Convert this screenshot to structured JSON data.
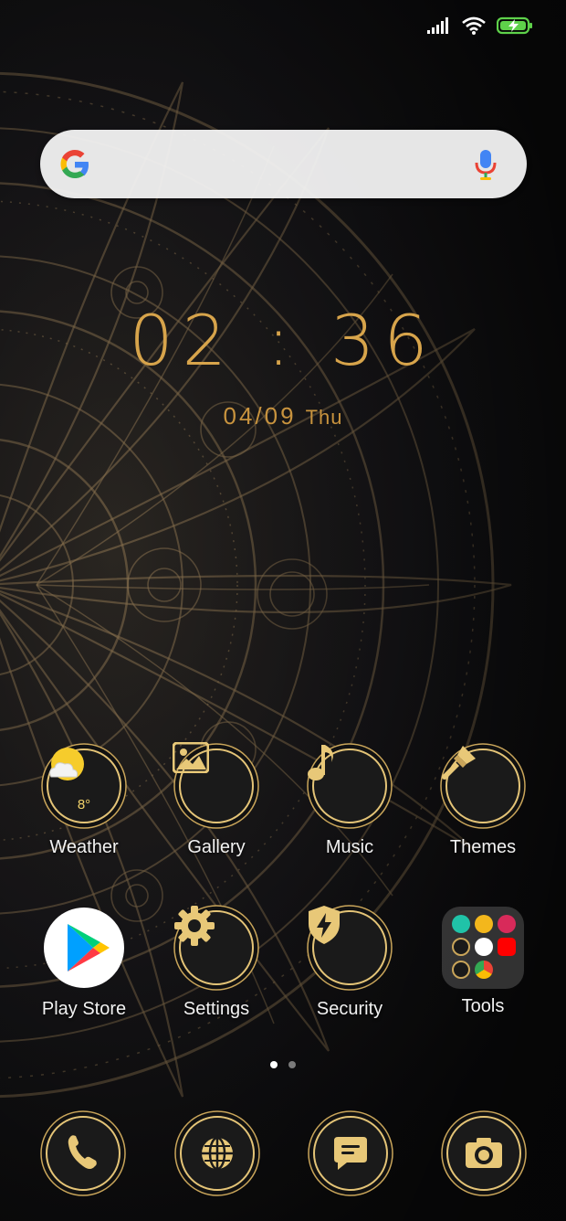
{
  "status_bar": {
    "signal": "signal-icon",
    "wifi": "wifi-icon",
    "battery": "battery-charging-icon"
  },
  "search": {
    "logo": "google-g-icon",
    "mic": "mic-icon"
  },
  "clock": {
    "time": "02 : 36",
    "date": "04/09",
    "weekday": "Thu"
  },
  "apps_row1": [
    {
      "label": "Weather",
      "icon": "weather-icon",
      "temp": "8°"
    },
    {
      "label": "Gallery",
      "icon": "gallery-icon"
    },
    {
      "label": "Music",
      "icon": "music-note-icon"
    },
    {
      "label": "Themes",
      "icon": "paintbrush-icon"
    }
  ],
  "apps_row2": [
    {
      "label": "Play Store",
      "icon": "play-store-icon"
    },
    {
      "label": "Settings",
      "icon": "gear-icon"
    },
    {
      "label": "Security",
      "icon": "shield-bolt-icon"
    },
    {
      "label": "Tools",
      "icon": "folder-icon"
    }
  ],
  "page_indicator": {
    "pages": 2,
    "current": 1
  },
  "dock": [
    {
      "icon": "phone-icon"
    },
    {
      "icon": "browser-globe-icon"
    },
    {
      "icon": "messages-icon"
    },
    {
      "icon": "camera-icon"
    }
  ],
  "colors": {
    "gold": "#d7a44b",
    "gold_light": "#f3d36a",
    "badge_dark": "#141414"
  }
}
